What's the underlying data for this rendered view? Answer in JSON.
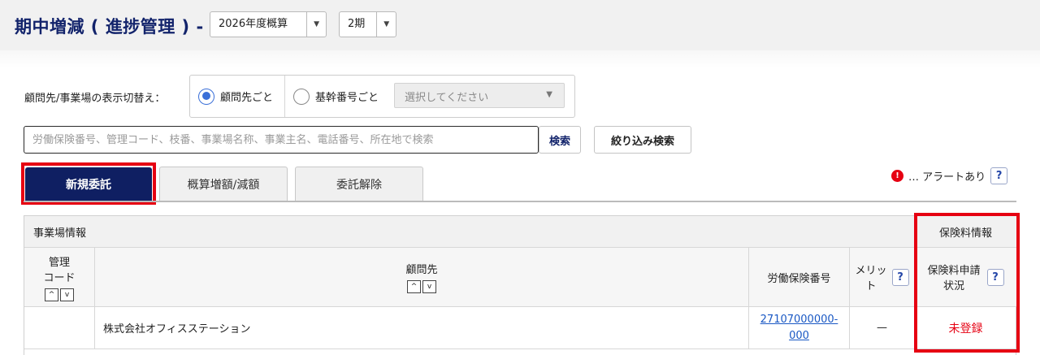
{
  "header": {
    "title": "期中増減 ( 進捗管理 ) -",
    "year_select": "2026年度概算",
    "period_select": "2期"
  },
  "switcher": {
    "label": "顧問先/事業場の表示切替え：",
    "option_client": "顧問先ごと",
    "option_base": "基幹番号ごと",
    "select_placeholder": "選択してください",
    "selected": "client"
  },
  "search": {
    "placeholder": "労働保険番号、管理コード、枝番、事業場名称、事業主名、電話番号、所在地で検索",
    "search_button": "検索",
    "filter_button": "絞り込み検索"
  },
  "tabs": [
    {
      "label": "新規委託",
      "active": true
    },
    {
      "label": "概算増額/減額",
      "active": false
    },
    {
      "label": "委託解除",
      "active": false
    }
  ],
  "alert": {
    "icon_text": "!",
    "text": "… アラートあり",
    "help": "?"
  },
  "table": {
    "group_office": "事業場情報",
    "group_premium": "保険料情報",
    "columns": {
      "code_line1": "管理",
      "code_line2": "コード",
      "client": "顧問先",
      "insurance_no": "労働保険番号",
      "merit_line1": "メリッ",
      "merit_line2": "ト",
      "status_line1": "保険料申請",
      "status_line2": "状況",
      "help": "?",
      "sort_up": "^",
      "sort_down": "v"
    },
    "rows": [
      {
        "code": "",
        "client": "株式会社オフィスステーション",
        "insurance_no_line1": "27107000000-",
        "insurance_no_line2": "000",
        "merit": "—",
        "status": "未登録"
      }
    ]
  },
  "colors": {
    "brand_navy": "#0f1f62",
    "highlight_red": "#e60012",
    "link_blue": "#1a58c4",
    "radio_blue": "#3a6fd8"
  }
}
